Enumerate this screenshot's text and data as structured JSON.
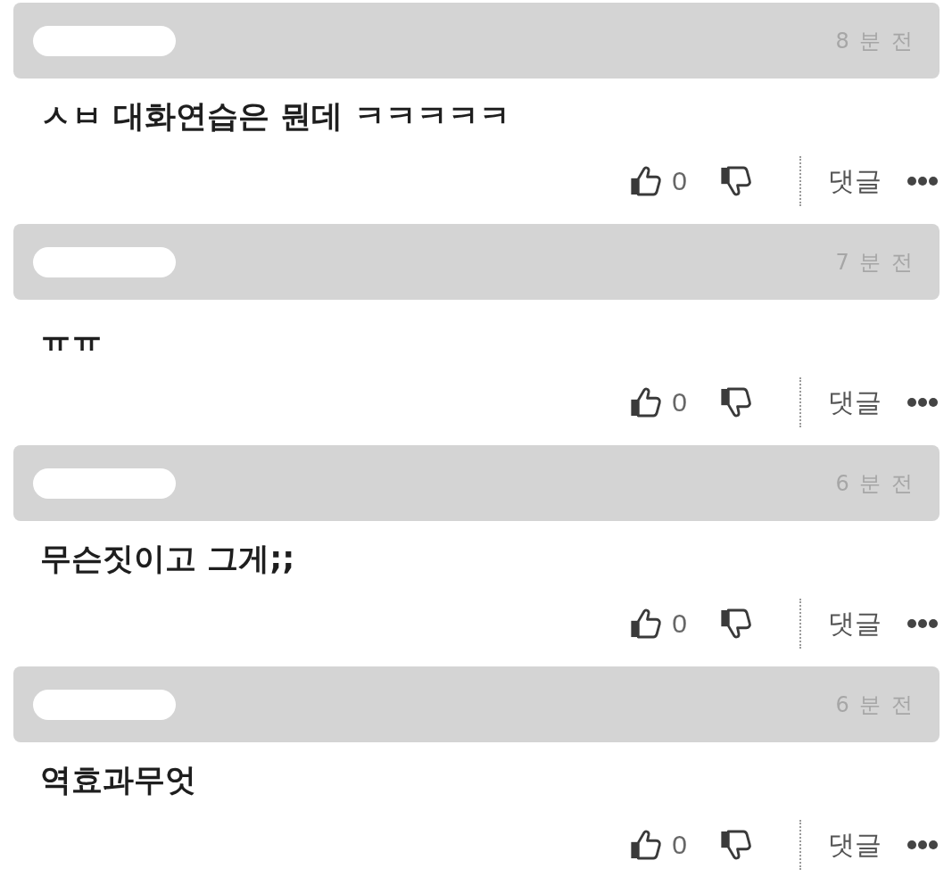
{
  "comments": [
    {
      "time": "8 분 전",
      "text": "ㅅㅂ 대화연습은 뭔데 ㅋㅋㅋㅋㅋ",
      "likes": "0",
      "reply_label": "댓글"
    },
    {
      "time": "7 분 전",
      "text": "ㅠㅠ",
      "likes": "0",
      "reply_label": "댓글"
    },
    {
      "time": "6 분 전",
      "text": "무슨짓이고 그게;;",
      "likes": "0",
      "reply_label": "댓글"
    },
    {
      "time": "6 분 전",
      "text": "역효과무엇",
      "likes": "0",
      "reply_label": "댓글"
    }
  ]
}
